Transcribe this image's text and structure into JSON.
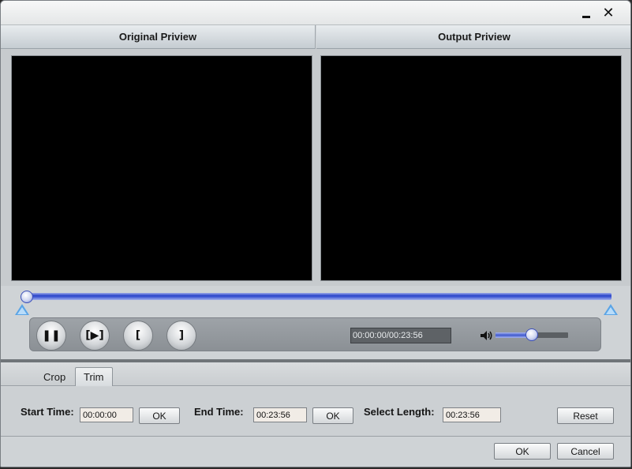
{
  "window": {
    "minimize_icon": "minimize-icon",
    "close_label": "✕"
  },
  "preview": {
    "original_title": "Original Priview",
    "output_title": "Output Priview"
  },
  "playback": {
    "timeline_position": 0.0,
    "time_display": "00:00:00/00:23:56",
    "volume_level": 0.5,
    "buttons": [
      {
        "name": "pause-button",
        "icon": "pause-icon",
        "glyph": "❚❚"
      },
      {
        "name": "next-frame-button",
        "icon": "next-frame-icon",
        "glyph": "[▶]"
      },
      {
        "name": "set-start-button",
        "icon": "left-bracket-icon",
        "glyph": "["
      },
      {
        "name": "set-end-button",
        "icon": "right-bracket-icon",
        "glyph": "]"
      }
    ]
  },
  "tabs": {
    "crop": "Crop",
    "trim": "Trim",
    "active": "Trim"
  },
  "trim": {
    "start_label": "Start Time:",
    "start_value": "00:00:00",
    "start_ok": "OK",
    "end_label": "End Time:",
    "end_value": "00:23:56",
    "end_ok": "OK",
    "length_label": "Select Length:",
    "length_value": "00:23:56",
    "reset": "Reset"
  },
  "footer": {
    "ok": "OK",
    "cancel": "Cancel"
  },
  "colors": {
    "accent_blue": "#2a43c8",
    "marker_blue": "#5aa4e6",
    "field_bg": "#f1ece6"
  }
}
